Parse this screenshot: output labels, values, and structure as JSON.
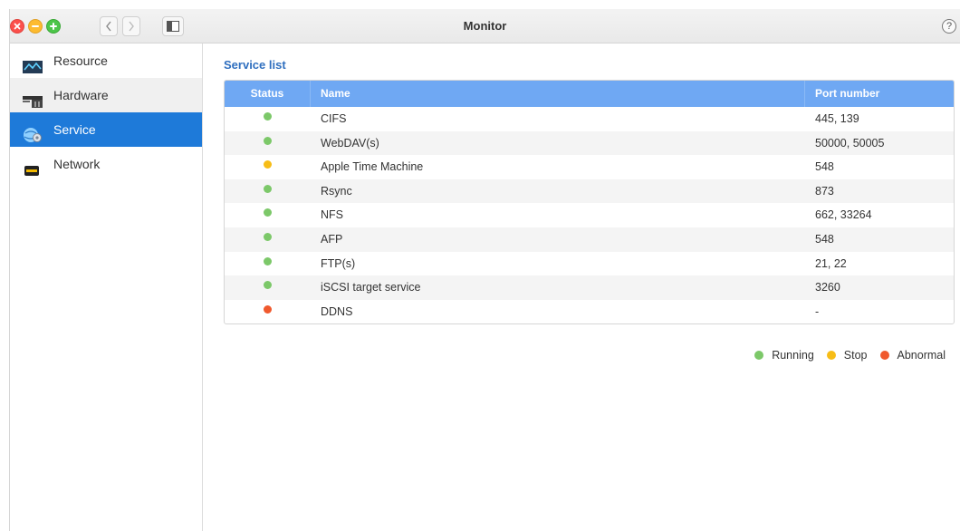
{
  "window": {
    "title": "Monitor",
    "help_glyph": "?"
  },
  "colors": {
    "running": "#7cc869",
    "stop": "#f7bd17",
    "abnormal": "#f0592d",
    "accent": "#1e7ad9",
    "header": "#6fa8f3"
  },
  "sidebar": {
    "items": [
      {
        "label": "Resource",
        "icon": "resource-chart-icon"
      },
      {
        "label": "Hardware",
        "icon": "hardware-icon"
      },
      {
        "label": "Service",
        "icon": "service-globe-gear-icon"
      },
      {
        "label": "Network",
        "icon": "network-icon"
      }
    ],
    "active_index": 2
  },
  "main": {
    "section_title": "Service list",
    "columns": [
      "Status",
      "Name",
      "Port number"
    ],
    "rows": [
      {
        "status": "running",
        "name": "CIFS",
        "port": "445, 139"
      },
      {
        "status": "running",
        "name": "WebDAV(s)",
        "port": "50000, 50005"
      },
      {
        "status": "stop",
        "name": "Apple Time Machine",
        "port": "548"
      },
      {
        "status": "running",
        "name": "Rsync",
        "port": "873"
      },
      {
        "status": "running",
        "name": "NFS",
        "port": "662, 33264"
      },
      {
        "status": "running",
        "name": "AFP",
        "port": "548"
      },
      {
        "status": "running",
        "name": "FTP(s)",
        "port": "21, 22"
      },
      {
        "status": "running",
        "name": "iSCSI target service",
        "port": "3260"
      },
      {
        "status": "abnormal",
        "name": "DDNS",
        "port": "-"
      }
    ],
    "legend": [
      {
        "key": "running",
        "label": "Running"
      },
      {
        "key": "stop",
        "label": "Stop"
      },
      {
        "key": "abnormal",
        "label": "Abnormal"
      }
    ]
  }
}
